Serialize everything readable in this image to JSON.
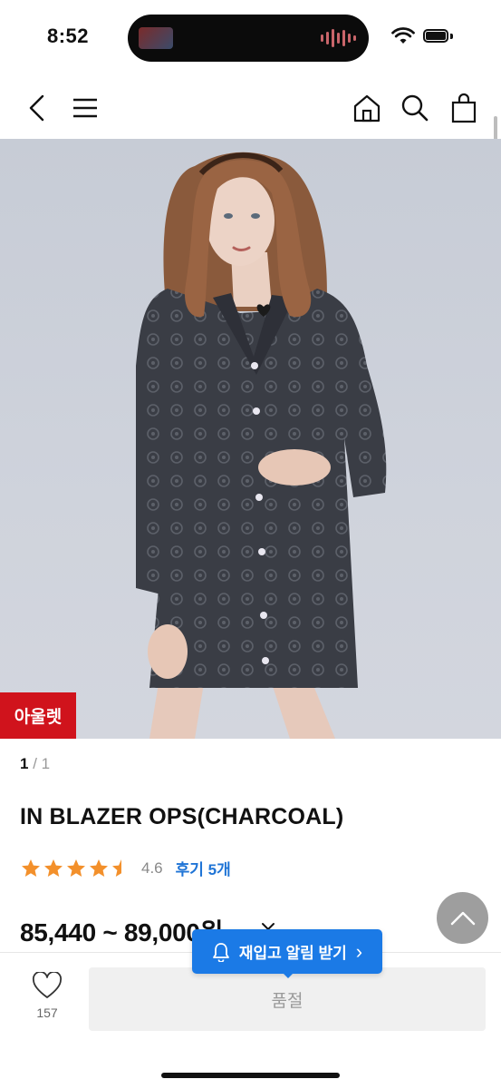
{
  "status_bar": {
    "time": "8:52"
  },
  "nav": {
    "back_icon": "back-chevron-icon",
    "menu_icon": "hamburger-menu-icon",
    "home_icon": "home-icon",
    "search_icon": "search-icon",
    "cart_icon": "shopping-bag-icon"
  },
  "product": {
    "badge": "아울렛",
    "pager_current": "1",
    "pager_total": "/ 1",
    "title": "IN BLAZER OPS(CHARCOAL)",
    "rating": "4.6",
    "rating_stars": 4.6,
    "review_link": "후기 5개",
    "price": "85,440 ~ 89,000원"
  },
  "actions": {
    "like_count": "157",
    "soldout_label": "품절",
    "restock_label": "재입고 알림 받기",
    "restock_chevron": "›"
  },
  "colors": {
    "accent": "#1b7ae6",
    "badge": "#d0131c",
    "star": "#f3902b"
  }
}
